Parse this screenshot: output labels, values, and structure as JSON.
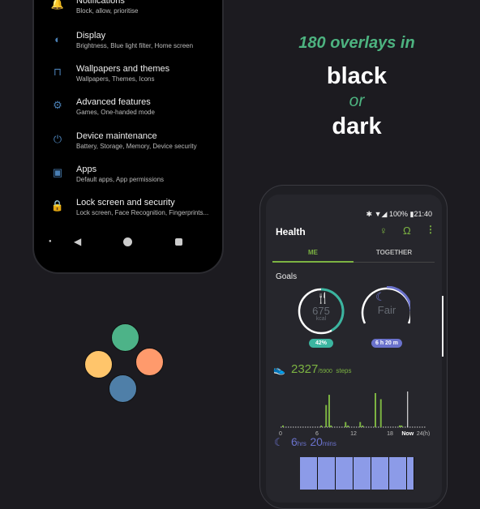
{
  "tagline": {
    "line1": "180 overlays in",
    "line2": "black",
    "line3": "or",
    "line4": "dark",
    "accent": "#4db380"
  },
  "settings": {
    "items": [
      {
        "title": "Notifications",
        "subtitle": "Block, allow, prioritise",
        "icon": "bell-icon"
      },
      {
        "title": "Display",
        "subtitle": "Brightness, Blue light filter, Home screen",
        "icon": "brightness-icon"
      },
      {
        "title": "Wallpapers and themes",
        "subtitle": "Wallpapers, Themes, Icons",
        "icon": "paintbrush-icon"
      },
      {
        "title": "Advanced features",
        "subtitle": "Games, One-handed mode",
        "icon": "gear-icon"
      },
      {
        "title": "Device maintenance",
        "subtitle": "Battery, Storage, Memory, Device security",
        "icon": "power-icon"
      },
      {
        "title": "Apps",
        "subtitle": "Default apps, App permissions",
        "icon": "android-icon"
      },
      {
        "title": "Lock screen and security",
        "subtitle": "Lock screen, Face Recognition, Fingerprints...",
        "icon": "lock-icon"
      }
    ],
    "icon_color": "#4a7fb4"
  },
  "palette": [
    "#4db388",
    "#ff9a6c",
    "#ffc56b",
    "#4f7fa8"
  ],
  "health": {
    "status": {
      "battery": "100%",
      "time": "21:40"
    },
    "title": "Health",
    "tabs": [
      "ME",
      "TOGETHER"
    ],
    "active_tab": 0,
    "goals_label": "Goals",
    "food": {
      "value": "675",
      "unit": "kcal",
      "percent": "42%",
      "progress": 0.42
    },
    "sleep_goal": {
      "label": "Fair",
      "duration": "6 h 20 m"
    },
    "steps": {
      "count": "2327",
      "goal": "/5900",
      "unit": "steps",
      "axis": [
        "0",
        "6",
        "12",
        "18",
        "Now",
        "24(h)"
      ],
      "now_hour": 20.9,
      "bars": [
        [
          0.4,
          0.05
        ],
        [
          6.7,
          0.05
        ],
        [
          7.5,
          0.65
        ],
        [
          8.0,
          0.95
        ],
        [
          8.3,
          0.05
        ],
        [
          10.7,
          0.15
        ],
        [
          11.1,
          0.05
        ],
        [
          13.1,
          0.15
        ],
        [
          13.5,
          0.05
        ],
        [
          15.6,
          1.0
        ],
        [
          16.5,
          0.82
        ],
        [
          19.6,
          0.05
        ],
        [
          19.9,
          0.05
        ]
      ]
    },
    "sleep": {
      "hours": "6",
      "hrs_label": "hrs",
      "minutes": "20",
      "mins_label": "mins"
    }
  }
}
